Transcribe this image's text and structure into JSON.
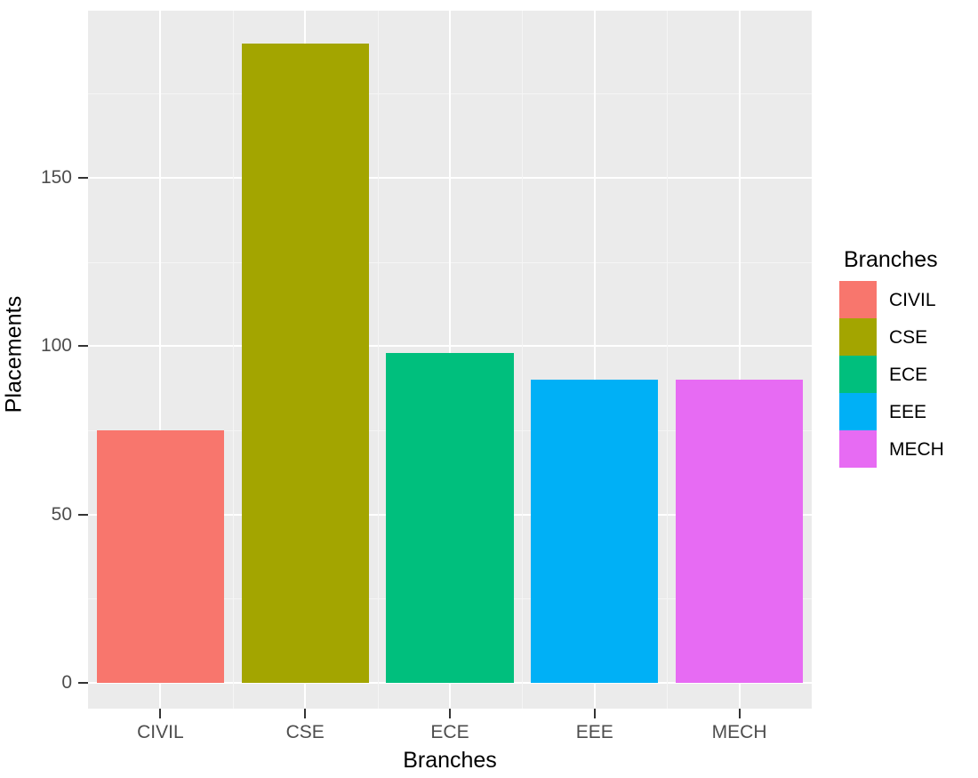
{
  "chart_data": {
    "type": "bar",
    "title": "",
    "subtitle": "",
    "categories": [
      "CIVIL",
      "CSE",
      "ECE",
      "EEE",
      "MECH"
    ],
    "values": [
      75,
      190,
      98,
      90,
      90
    ],
    "xlabel": "Branches",
    "ylabel": "Placements",
    "ylim": [
      0,
      198
    ],
    "xtick_labels": [
      "CIVIL",
      "CSE",
      "ECE",
      "EEE",
      "MECH"
    ],
    "ytick_labels": [
      "0",
      "50",
      "100",
      "150"
    ],
    "ytick_values": [
      0,
      50,
      100,
      150
    ],
    "yminor_values": [
      25,
      75,
      125,
      175
    ],
    "grid": true,
    "legend_position": "right",
    "legend": {
      "title": "Branches",
      "entries": [
        {
          "label": "CIVIL",
          "color": "#F8766D"
        },
        {
          "label": "CSE",
          "color": "#A3A500"
        },
        {
          "label": "ECE",
          "color": "#00BF7D"
        },
        {
          "label": "EEE",
          "color": "#00B0F6"
        },
        {
          "label": "MECH",
          "color": "#E76BF3"
        }
      ]
    },
    "series": [
      {
        "name": "Placements",
        "points": [
          {
            "category": "CIVIL",
            "value": 75,
            "color": "#F8766D"
          },
          {
            "category": "CSE",
            "value": 190,
            "color": "#A3A500"
          },
          {
            "category": "ECE",
            "value": 98,
            "color": "#00BF7D"
          },
          {
            "category": "EEE",
            "value": 90,
            "color": "#00B0F6"
          },
          {
            "category": "MECH",
            "value": 90,
            "color": "#E76BF3"
          }
        ]
      }
    ],
    "theme": {
      "panel_background": "#EBEBEB",
      "grid_major_color": "#FFFFFF",
      "grid_minor_color": "#F5F5F5",
      "plot_background": "#FFFFFF",
      "axis_text_color": "#4D4D4D",
      "axis_title_color": "#000000"
    }
  },
  "axes": {
    "y": {
      "title": "Placements"
    },
    "x": {
      "title": "Branches"
    }
  }
}
